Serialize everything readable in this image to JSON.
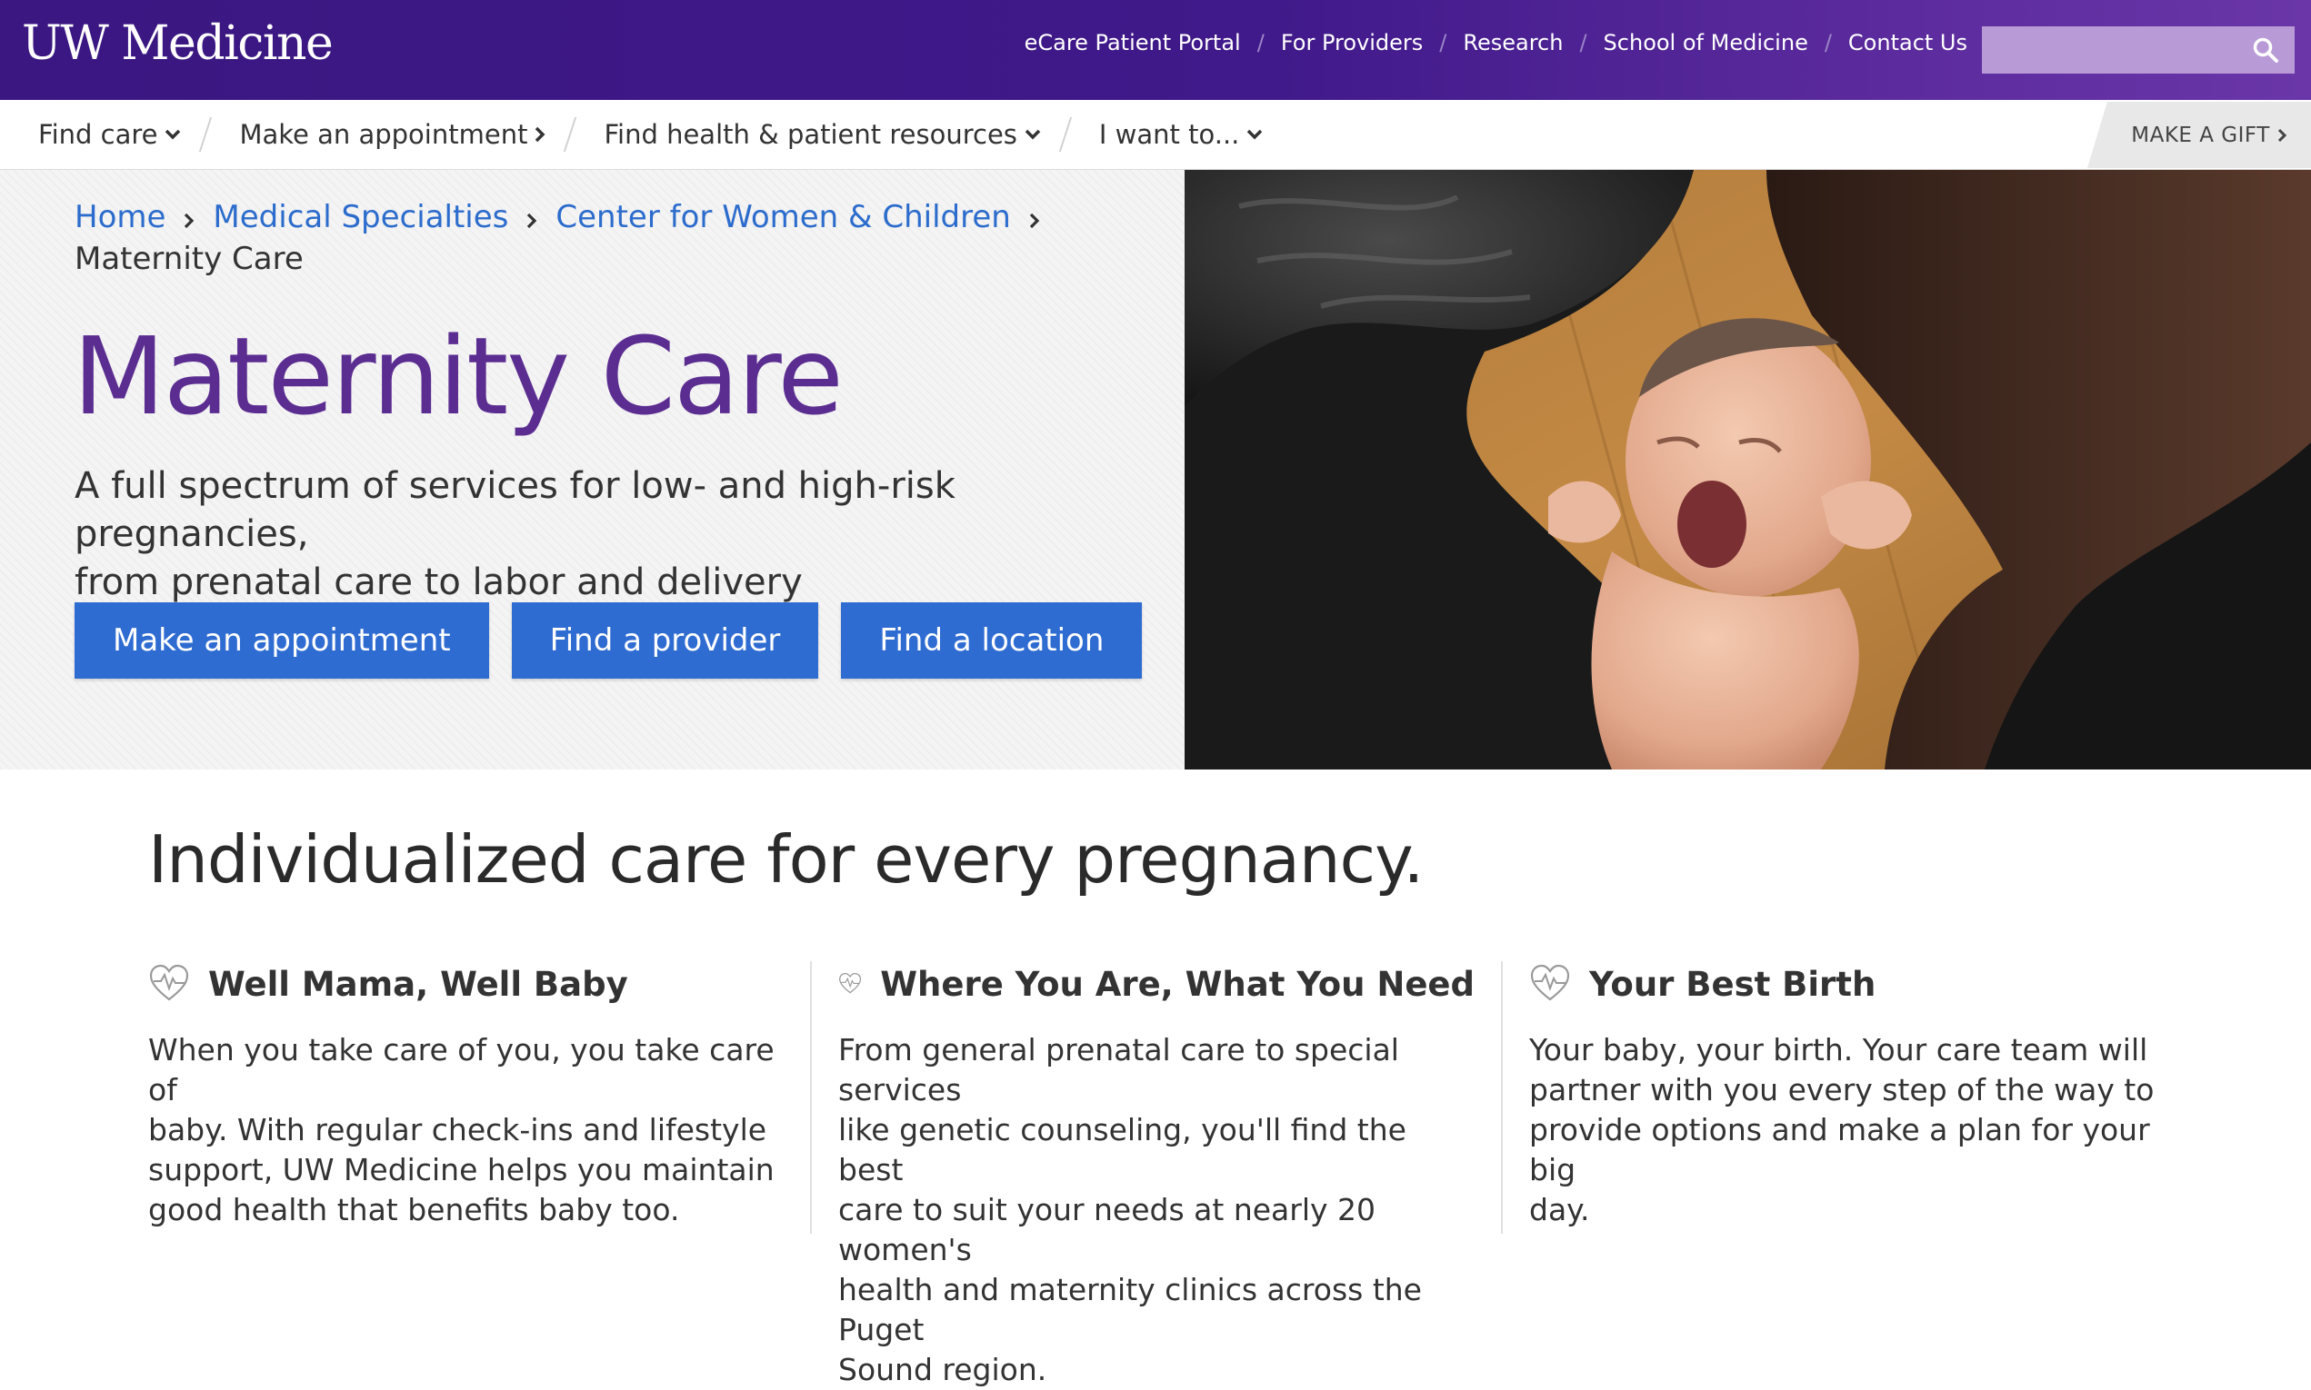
{
  "header": {
    "logo": "UW Medicine",
    "utility_links": [
      "eCare Patient Portal",
      "For Providers",
      "Research",
      "School of Medicine",
      "Contact Us"
    ],
    "search": {
      "placeholder": "",
      "icon": "search-icon"
    }
  },
  "nav": {
    "items": [
      {
        "label": "Find care",
        "icon": "chevron-down-icon"
      },
      {
        "label": "Make an appointment",
        "icon": "chevron-right-icon"
      },
      {
        "label": "Find health & patient resources",
        "icon": "chevron-down-icon"
      },
      {
        "label": "I want to...",
        "icon": "chevron-down-icon"
      }
    ],
    "gift": {
      "label": "MAKE A GIFT",
      "icon": "chevron-right-icon"
    }
  },
  "hero": {
    "breadcrumb": [
      "Home",
      "Medical Specialties",
      "Center for Women & Children",
      "Maternity Care"
    ],
    "title": "Maternity Care",
    "subtitle_lines": [
      "A full spectrum of services for low- and high-risk pregnancies,",
      "from prenatal care to labor and delivery"
    ],
    "buttons": [
      "Make an appointment",
      "Find a provider",
      "Find a location"
    ]
  },
  "content": {
    "heading": "Individualized care for every pregnancy.",
    "columns": [
      {
        "icon": "heart-pulse-icon",
        "title": "Well Mama, Well Baby",
        "lines": [
          "When you take care of you, you take care of",
          "baby. With regular check-ins and lifestyle",
          "support, UW Medicine helps you maintain",
          "good health that benefits baby too."
        ]
      },
      {
        "icon": "heart-pulse-icon",
        "title": "Where You Are, What You Need",
        "lines": [
          "From general prenatal care to special services",
          "like genetic counseling, you'll find the best",
          "care to suit your needs at nearly 20 women's",
          "health and maternity clinics across the Puget",
          "Sound region."
        ]
      },
      {
        "icon": "heart-pulse-icon",
        "title": "Your Best Birth",
        "lines": [
          "Your baby, your birth. Your care team will",
          "partner with you every step of the way to",
          "provide options and make a plan for your big",
          "day."
        ]
      }
    ]
  },
  "colors": {
    "brand_purple": "#3a1781",
    "title_purple": "#5b2d91",
    "link_blue": "#2c6ccc",
    "button_blue": "#2f6cd2"
  }
}
